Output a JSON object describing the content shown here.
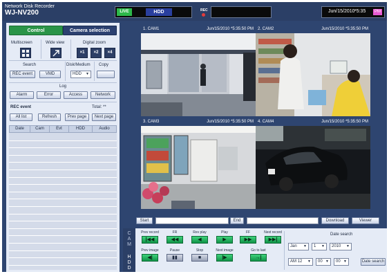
{
  "header": {
    "app_line": "Network Disk Recorder",
    "model": "WJ-NV200",
    "live_label": "LIVE",
    "hdd_label": "HDD",
    "rec_label": "REC",
    "date": "Jun/15/2010",
    "time": "*5:35",
    "ampm": "PM"
  },
  "tabs": {
    "control": "Control",
    "camera": "Camera selection"
  },
  "left": {
    "multiscreen": "Multiscreen",
    "wide_view": "Wide view",
    "digital_zoom": "Digital zoom",
    "zoom_x1": "×1",
    "zoom_x2": "×2",
    "zoom_x4": "×4",
    "search": "Search",
    "disk_medium": "Disk/Medium",
    "copy": "Copy",
    "rec_event_btn": "REC event",
    "vmd_btn": "VMD",
    "hdd_select": "HDD",
    "log": "Log",
    "alarm": "Alarm",
    "error": "Error",
    "access": "Access",
    "network": "Network",
    "rec_event_title": "REC event",
    "total": "Total: **",
    "all_list": "All list",
    "refresh": "Refresh",
    "prev_page": "Prev page",
    "next_page": "Next page",
    "columns": [
      "Date",
      "Cam",
      "Evt",
      "HDD",
      "Audio"
    ]
  },
  "cams": [
    {
      "name": "1. CAM1",
      "ts": "Jun/15/2010  *5:35:50 PM"
    },
    {
      "name": "2. CAM2",
      "ts": "Jun/15/2010  *5:35:50 PM"
    },
    {
      "name": "3. CAM3",
      "ts": "Jun/15/2010  *5:35:50 PM"
    },
    {
      "name": "4. CAM4",
      "ts": "Jun/15/2010  *5:35:50 PM"
    }
  ],
  "searchbar": {
    "start": "Start",
    "end": "End",
    "download": "Download",
    "viewer": "Viewer"
  },
  "side": {
    "cam": "CAM",
    "hdd": "HDD"
  },
  "playback": {
    "prev_record": "Prev record",
    "fr": "FR",
    "rev_play": "Rev play",
    "play": "Play",
    "ff": "FF",
    "next_record": "Next record",
    "prev_image": "Prev image",
    "pause": "Pause",
    "stop": "Stop",
    "next_image": "Next image",
    "go_to_last": "Go to last"
  },
  "date_search": {
    "title": "Date search",
    "month": "Jan",
    "day": "1",
    "year": "2010",
    "ampm": "AM 12",
    "minute": "00",
    "second": "00",
    "button": "Date search"
  },
  "colors": {
    "frame": "#2e4570",
    "accent_green": "#2a9448",
    "panel": "#e5ebf6",
    "pm": "#e75ad1"
  }
}
